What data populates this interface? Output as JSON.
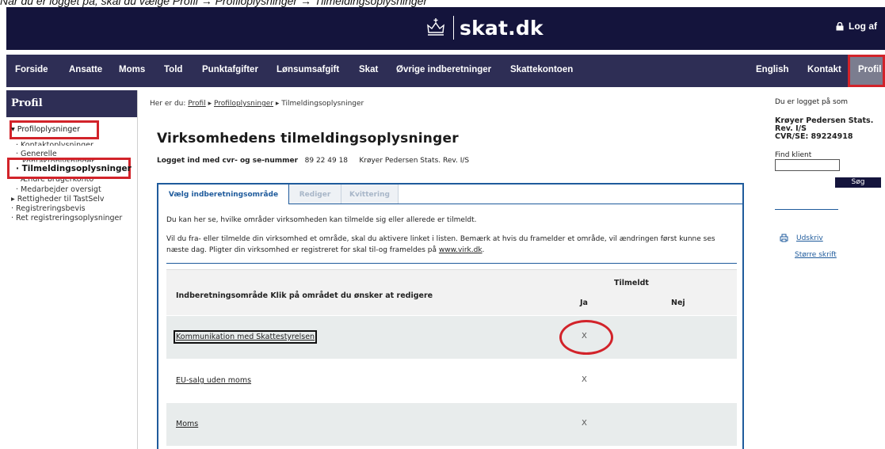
{
  "caption": {
    "prefix": "Når du er logget på, skal du vælge ",
    "path": "Profil → Profiloplysninger → Tilmeldingsoplysninger"
  },
  "header": {
    "brand": "skat.dk",
    "logout": "Log af"
  },
  "nav": {
    "items": [
      "Forside",
      "Ansatte",
      "Moms",
      "Told",
      "Punktafgifter",
      "Lønsumsafgift",
      "Skat",
      "Øvrige indberetninger",
      "Skattekontoen"
    ],
    "right_items": [
      "English",
      "Kontakt"
    ],
    "active": "Profil"
  },
  "sidebar": {
    "title": "Profil",
    "items": [
      {
        "label": "▾ Profiloplysninger"
      },
      {
        "label": "· Kontaktoplysninger"
      },
      {
        "label": "· Generelle"
      },
      {
        "label": "kontaktoplysninger"
      },
      {
        "label": "· Tilmeldingsoplysninger"
      },
      {
        "label": "· Ændre brugerkonto"
      },
      {
        "label": "· Medarbejder oversigt"
      },
      {
        "label": "▸ Rettigheder til TastSelv"
      },
      {
        "label": "· Registreringsbevis"
      },
      {
        "label": "· Ret registreringsoplysninger"
      }
    ]
  },
  "breadcrumb": {
    "prefix": "Her er du: ",
    "items": [
      "Profil",
      "Profiloplysninger",
      "Tilmeldingsoplysninger"
    ],
    "sep": " ▸ "
  },
  "main": {
    "title": "Virksomhedens tilmeldingsoplysninger",
    "logged_label": "Logget ind med cvr- og se-nummer",
    "logged_number": "89 22 49 18",
    "logged_company": "Krøyer Pedersen Stats. Rev. I/S",
    "tabs": [
      "Vælg indberetningsområde",
      "Rediger",
      "Kvittering"
    ],
    "intro": "Du kan her se, hvilke områder virksomheden kan tilmelde sig eller allerede er tilmeldt.",
    "para": "Vil du fra- eller tilmelde din virksomhed et område, skal du aktivere linket i listen. Bemærk at hvis du framelder et område, vil ændringen først kunne ses næste dag. Pligter din virksomhed er registreret for skal til-og frameldes på",
    "para_link": "www.virk.dk",
    "table": {
      "col_main": "Indberetningsområde Klik på området du ønsker at redigere",
      "col_group": "Tilmeldt",
      "col_yes": "Ja",
      "col_no": "Nej",
      "rows": [
        {
          "name": "Kommunikation med Skattestyrelsen",
          "ja": "X",
          "nej": ""
        },
        {
          "name": "EU-salg uden moms",
          "ja": "X",
          "nej": ""
        },
        {
          "name": "Moms",
          "ja": "X",
          "nej": ""
        }
      ]
    }
  },
  "right": {
    "logged_as": "Du er logget på som",
    "name_line1": "Krøyer Pedersen Stats.",
    "name_line2": "Rev. I/S",
    "cvr_line": "CVR/SE: 89224918",
    "find_label": "Find klient",
    "search_button": "Søg",
    "print_label": "Udskriv",
    "larger_text": "Større skrift"
  },
  "colors": {
    "header_bg": "#14143c",
    "nav_bg": "#2e2e55",
    "accent_blue": "#1f5b9c",
    "highlight_red": "#d2232a"
  }
}
